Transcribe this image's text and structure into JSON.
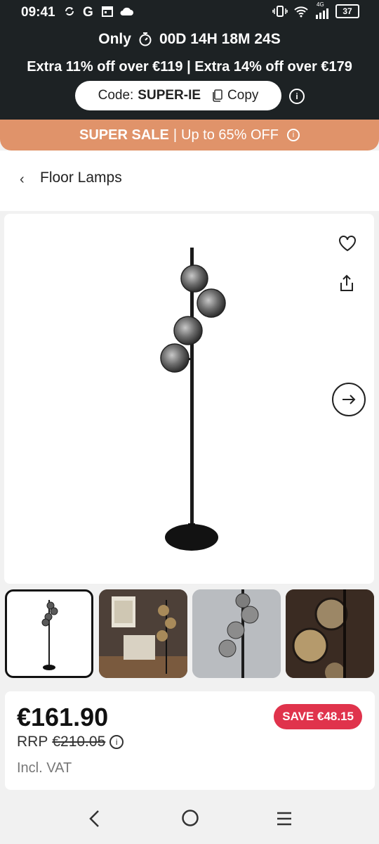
{
  "status_bar": {
    "time": "09:41",
    "left_icons": [
      "sync-icon",
      "google-icon",
      "calendar-icon",
      "cloud-icon"
    ],
    "right_icons": [
      "vibrate-icon",
      "wifi-icon",
      "signal-icon"
    ],
    "network": "4G",
    "battery": "37"
  },
  "promo": {
    "countdown_prefix": "Only",
    "countdown": "00D 14H 18M 24S",
    "offer": "Extra 11% off over €119 | Extra 14% off over €179",
    "code_label": "Code:",
    "code_value": "SUPER-IE",
    "copy_label": "Copy"
  },
  "sale_bar": {
    "bold": "SUPER SALE",
    "separator": "|",
    "text": "Up to 65% OFF"
  },
  "breadcrumb": {
    "back": "‹",
    "title": "Floor Lamps"
  },
  "price_card": {
    "price": "€161.90",
    "save_badge": "SAVE €48.15",
    "rrp_label": "RRP",
    "rrp_value": "€210.05",
    "vat": "Incl. VAT"
  },
  "colors": {
    "dark": "#1d2224",
    "sale_bar": "#e0936a",
    "save_badge": "#e0334c"
  }
}
